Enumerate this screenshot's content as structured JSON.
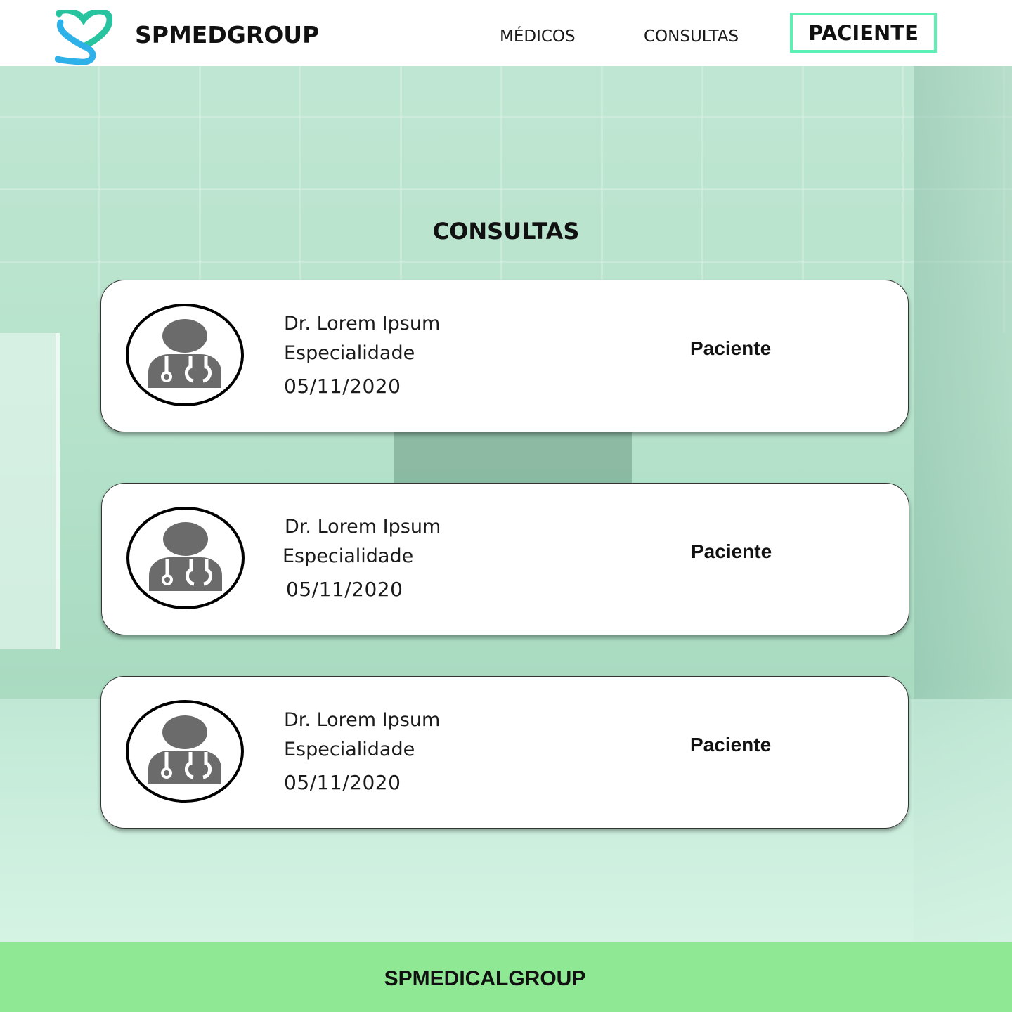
{
  "header": {
    "brand": "SPMEDGROUP",
    "logo_icon": "heart-s-logo-icon",
    "nav": {
      "medicos": "MÉDICOS",
      "consultas": "CONSULTAS",
      "paciente": "PACIENTE"
    }
  },
  "main": {
    "title": "CONSULTAS",
    "cards": [
      {
        "doctor": "Dr. Lorem Ipsum",
        "specialty": "Especialidade",
        "date": "05/11/2020",
        "patient": "Paciente",
        "icon": "doctor-icon"
      },
      {
        "doctor": "Dr. Lorem Ipsum",
        "specialty": "Especialidade",
        "date": "05/11/2020",
        "patient": "Paciente",
        "icon": "doctor-icon"
      },
      {
        "doctor": "Dr. Lorem Ipsum",
        "specialty": "Especialidade",
        "date": "05/11/2020",
        "patient": "Paciente",
        "icon": "doctor-icon"
      }
    ]
  },
  "footer": {
    "text": "SPMEDICALGROUP"
  },
  "colors": {
    "accent_border": "#5cf0b4",
    "footer_bg": "#8ee894",
    "hero_tint": "#b6e2cb",
    "icon_gray": "#6b6b6b"
  }
}
